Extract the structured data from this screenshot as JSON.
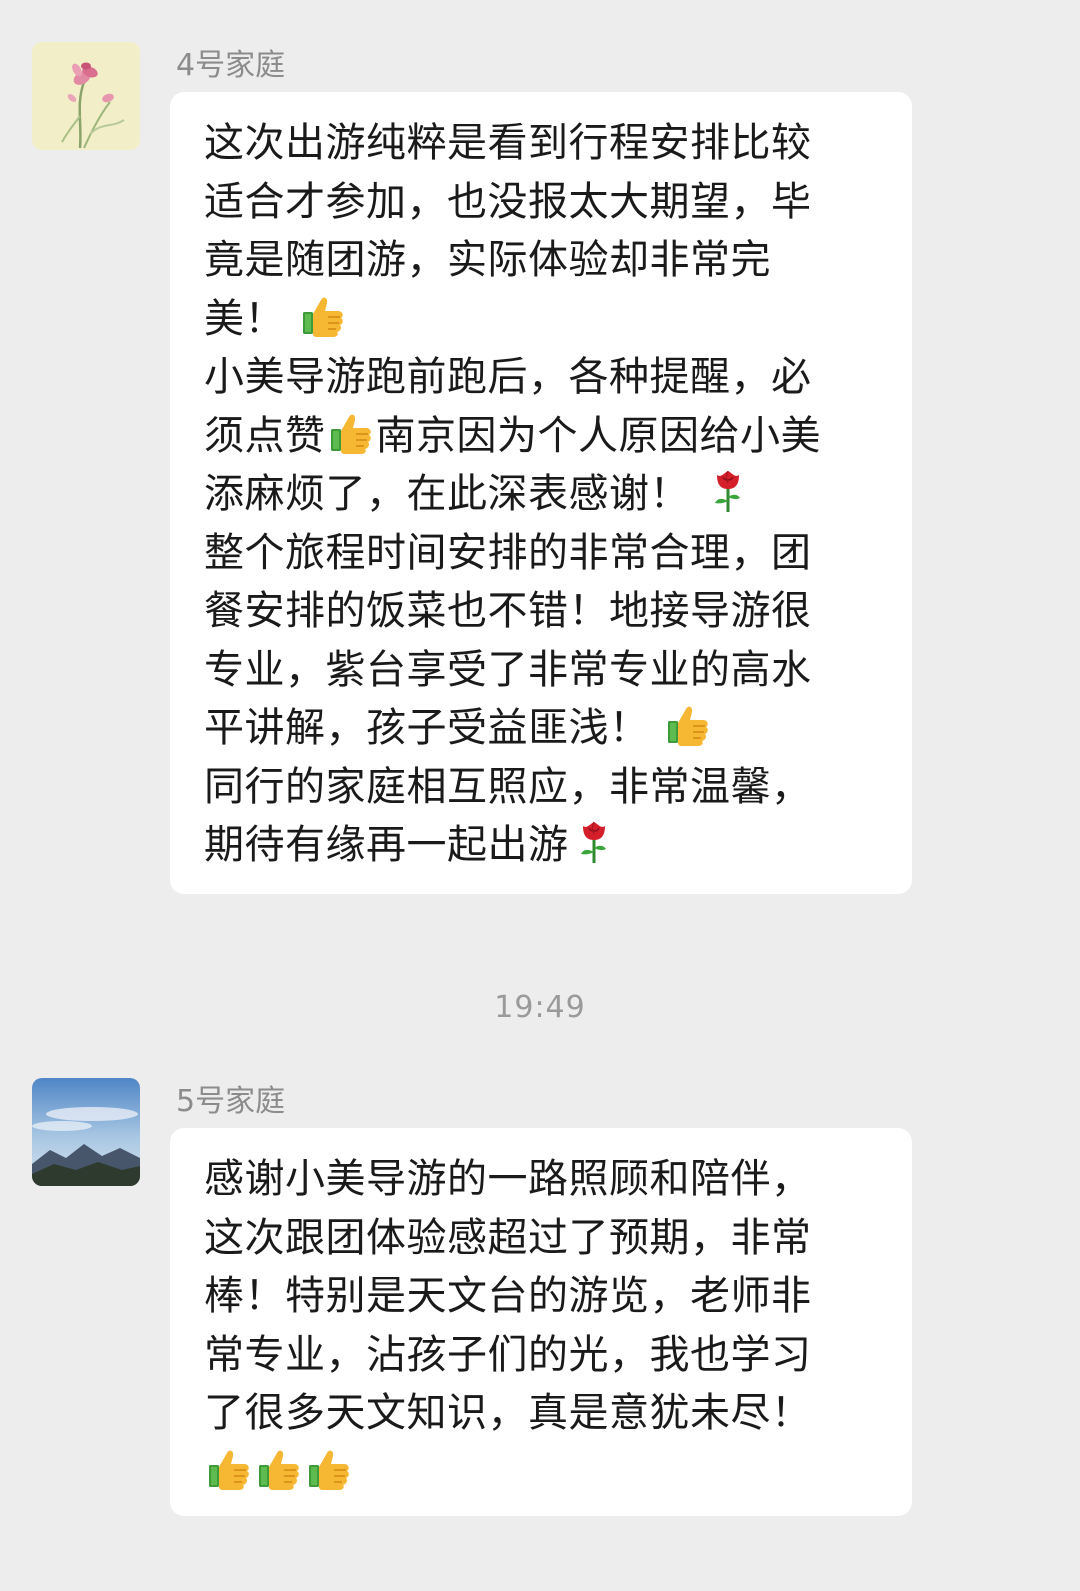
{
  "messages": [
    {
      "sender": "4号家庭",
      "avatar": "flower-painting-avatar",
      "lines": [
        {
          "segments": [
            {
              "t": "这次出游纯粹是看到行程安排比较"
            }
          ]
        },
        {
          "segments": [
            {
              "t": "适合才参加，也没报太大期望，毕"
            }
          ]
        },
        {
          "segments": [
            {
              "t": "竟是随团游，实际体验却非常完"
            }
          ]
        },
        {
          "segments": [
            {
              "t": "美！ "
            },
            {
              "icon": "thumbs-up-icon"
            }
          ]
        },
        {
          "segments": [
            {
              "t": "小美导游跑前跑后，各种提醒，必"
            }
          ]
        },
        {
          "segments": [
            {
              "t": "须点赞"
            },
            {
              "icon": "thumbs-up-icon"
            },
            {
              "t": "南京因为个人原因给小美"
            }
          ]
        },
        {
          "segments": [
            {
              "t": "添麻烦了，在此深表感谢！ "
            },
            {
              "icon": "rose-icon"
            }
          ]
        },
        {
          "segments": [
            {
              "t": "整个旅程时间安排的非常合理，团"
            }
          ]
        },
        {
          "segments": [
            {
              "t": "餐安排的饭菜也不错！地接导游很"
            }
          ]
        },
        {
          "segments": [
            {
              "t": "专业，紫台享受了非常专业的高水"
            }
          ]
        },
        {
          "segments": [
            {
              "t": "平讲解，孩子受益匪浅！ "
            },
            {
              "icon": "thumbs-up-icon"
            }
          ]
        },
        {
          "segments": [
            {
              "t": "同行的家庭相互照应，非常温馨，"
            }
          ]
        },
        {
          "segments": [
            {
              "t": "期待有缘再一起出游"
            },
            {
              "icon": "rose-icon"
            }
          ]
        }
      ]
    },
    {
      "sender": "5号家庭",
      "avatar": "mountain-sky-avatar",
      "lines": [
        {
          "segments": [
            {
              "t": "感谢小美导游的一路照顾和陪伴，"
            }
          ]
        },
        {
          "segments": [
            {
              "t": "这次跟团体验感超过了预期，非常"
            }
          ]
        },
        {
          "segments": [
            {
              "t": "棒！特别是天文台的游览，老师非"
            }
          ]
        },
        {
          "segments": [
            {
              "t": "常专业，沾孩子们的光，我也学习"
            }
          ]
        },
        {
          "segments": [
            {
              "t": "了很多天文知识，真是意犹未尽！"
            }
          ]
        },
        {
          "segments": [
            {
              "icon": "thumbs-up-icon"
            },
            {
              "icon": "thumbs-up-icon"
            },
            {
              "icon": "thumbs-up-icon"
            }
          ]
        }
      ]
    }
  ],
  "timestamp": "19:49",
  "colors": {
    "background": "#ededed",
    "bubble": "#ffffff",
    "sender_text": "#8c8c8c",
    "timestamp_text": "#9a9a9a"
  }
}
